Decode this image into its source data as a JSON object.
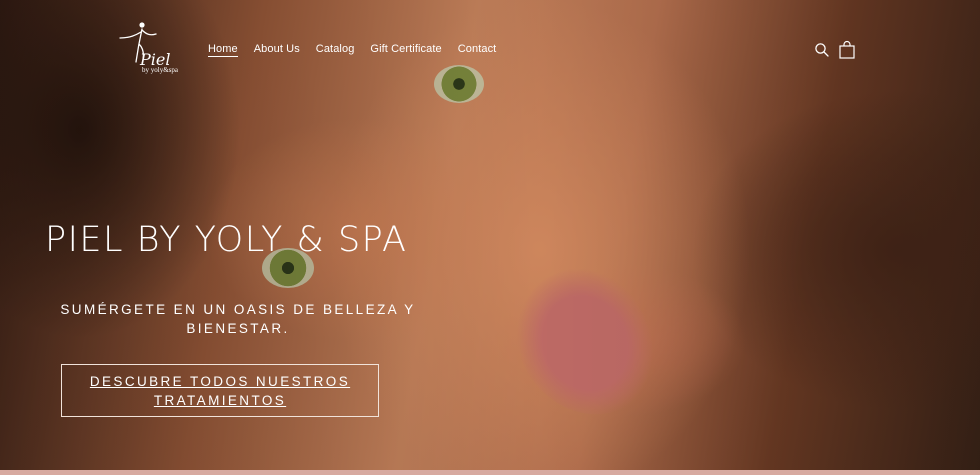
{
  "brand": {
    "logo_script": "Piel",
    "logo_tagline": "by yoly&spa",
    "icon": "dancer-logo-icon"
  },
  "nav": {
    "items": [
      {
        "label": "Home",
        "active": true
      },
      {
        "label": "About Us",
        "active": false
      },
      {
        "label": "Catalog",
        "active": false
      },
      {
        "label": "Gift Certificate",
        "active": false
      },
      {
        "label": "Contact",
        "active": false
      }
    ]
  },
  "header_icons": {
    "search": "search-icon",
    "cart": "shopping-bag-icon"
  },
  "hero": {
    "title": "PIEL BY YOLY & SPA",
    "subtitle": "SUMÉRGETE EN UN OASIS DE BELLEZA Y BIENESTAR.",
    "cta_label": "DESCUBRE TODOS NUESTROS TRATAMIENTOS"
  },
  "colors": {
    "text": "#ffffff",
    "cta_border": "#f1e3da",
    "bottom_strip": "#d7a9a0"
  }
}
